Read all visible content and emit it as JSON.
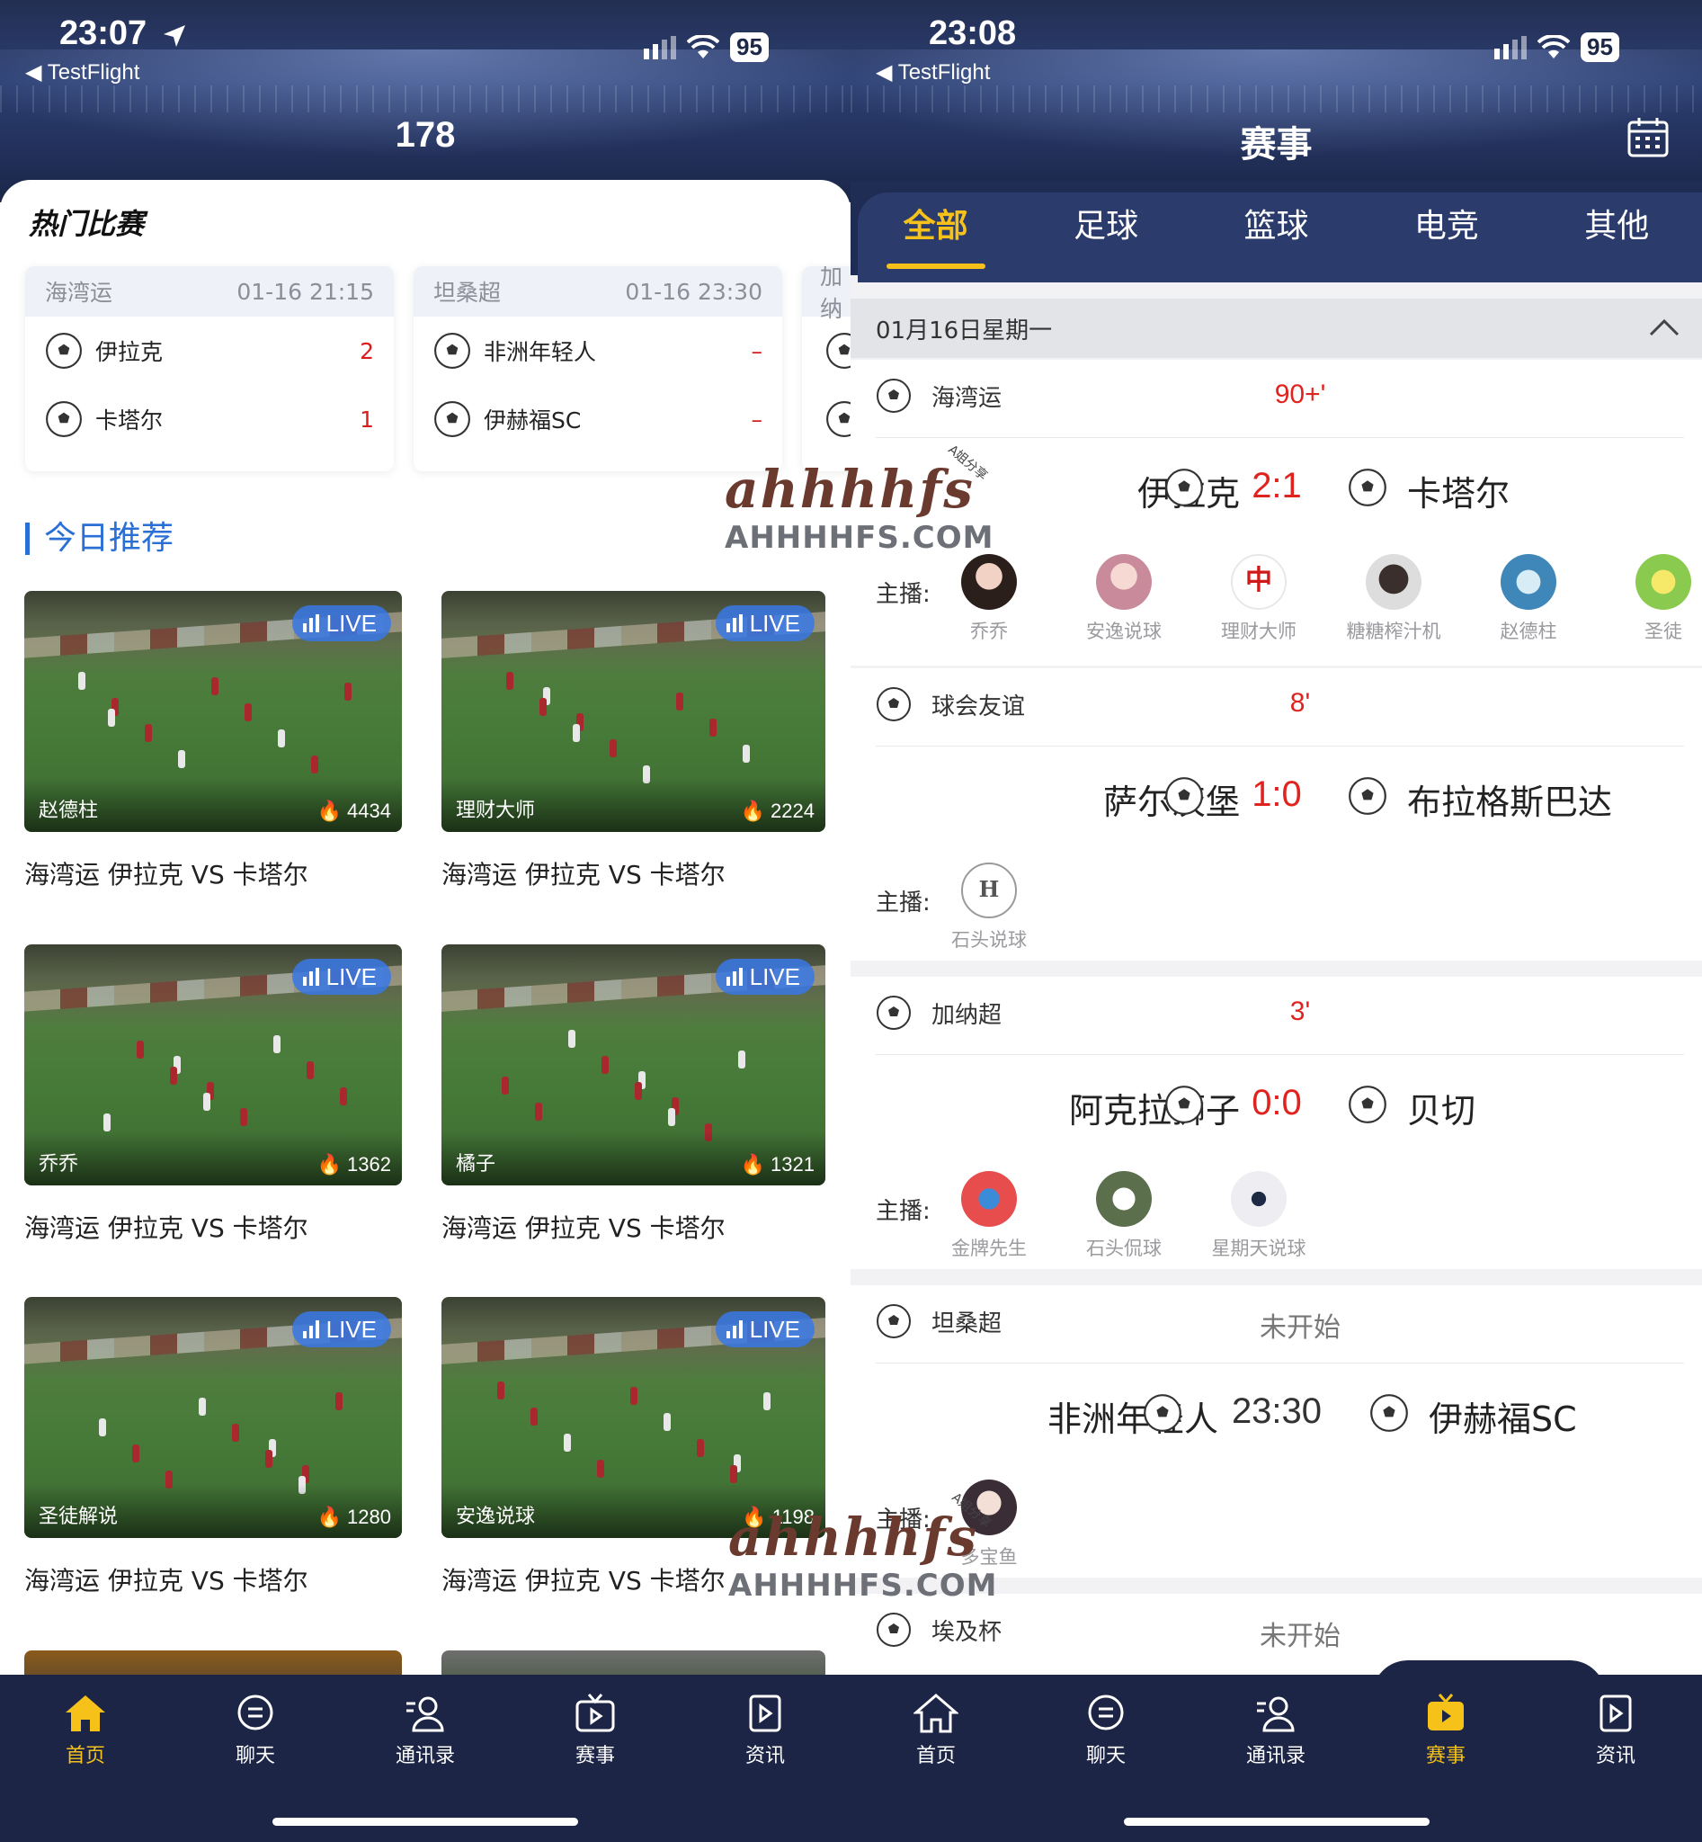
{
  "left": {
    "status": {
      "time": "23:07",
      "back": "TestFlight",
      "battery": "95"
    },
    "title": "178",
    "hot_title": "热门比赛",
    "matches": [
      {
        "league": "海湾运",
        "time": "01-16 21:15",
        "home": "伊拉克",
        "home_score": "2",
        "away": "卡塔尔",
        "away_score": "1"
      },
      {
        "league": "坦桑超",
        "time": "01-16 23:30",
        "home": "非洲年轻人",
        "home_score": "–",
        "away": "伊赫福SC",
        "away_score": "–"
      },
      {
        "league": "加纳"
      }
    ],
    "rec_title": "今日推荐",
    "live_label": "LIVE",
    "videos": [
      {
        "anchor": "赵德柱",
        "heat": "4434",
        "title": "海湾运 伊拉克 VS 卡塔尔"
      },
      {
        "anchor": "理财大师",
        "heat": "2224",
        "title": "海湾运 伊拉克 VS 卡塔尔"
      },
      {
        "anchor": "乔乔",
        "heat": "1362",
        "title": "海湾运 伊拉克 VS 卡塔尔"
      },
      {
        "anchor": "橘子",
        "heat": "1321",
        "title": "海湾运 伊拉克 VS 卡塔尔"
      },
      {
        "anchor": "圣徒解说",
        "heat": "1280",
        "title": "海湾运 伊拉克 VS 卡塔尔"
      },
      {
        "anchor": "安逸说球",
        "heat": "1198",
        "title": "海湾运 伊拉克 VS 卡塔尔"
      }
    ],
    "tabs": [
      {
        "label": "首页",
        "icon": "home-icon",
        "active": true
      },
      {
        "label": "聊天",
        "icon": "chat-icon",
        "active": false
      },
      {
        "label": "通讯录",
        "icon": "contacts-icon",
        "active": false
      },
      {
        "label": "赛事",
        "icon": "tv-icon",
        "active": false
      },
      {
        "label": "资讯",
        "icon": "news-icon",
        "active": false
      }
    ]
  },
  "right": {
    "status": {
      "time": "23:08",
      "back": "TestFlight",
      "battery": "95"
    },
    "title": "赛事",
    "categories": [
      "全部",
      "足球",
      "篮球",
      "电竞",
      "其他"
    ],
    "active_category": "全部",
    "date_header": "01月16日星期一",
    "host_label": "主播:",
    "matches": [
      {
        "league": "海湾运",
        "status": "90+'",
        "home": "伊拉克",
        "score": "2:1",
        "away": "卡塔尔",
        "hosts": [
          "乔乔",
          "安逸说球",
          "理财大师",
          "糖糖榨汁机",
          "赵德柱",
          "圣徒"
        ]
      },
      {
        "league": "球会友谊",
        "status": "8'",
        "home": "萨尔茨堡",
        "score": "1:0",
        "away": "布拉格斯巴达",
        "hosts": [
          "石头说球"
        ]
      },
      {
        "league": "加纳超",
        "status": "3'",
        "home": "阿克拉狮子",
        "score": "0:0",
        "away": "贝切",
        "hosts": [
          "金牌先生",
          "石头侃球",
          "星期天说球"
        ]
      },
      {
        "league": "坦桑超",
        "status": "未开始",
        "home": "非洲年轻人",
        "score": "23:30",
        "away": "伊赫福SC",
        "hosts": [
          "多宝鱼"
        ]
      },
      {
        "league": "埃及杯",
        "status": "未开始"
      }
    ],
    "tabs": [
      {
        "label": "首页",
        "icon": "home-icon",
        "active": false
      },
      {
        "label": "聊天",
        "icon": "chat-icon",
        "active": false
      },
      {
        "label": "通讯录",
        "icon": "contacts-icon",
        "active": false
      },
      {
        "label": "赛事",
        "icon": "tv-icon",
        "active": true
      },
      {
        "label": "资讯",
        "icon": "news-icon",
        "active": false
      }
    ]
  },
  "watermark": {
    "line1": "ahhhhfs",
    "line2": "AHHHHFS.COM",
    "tag": "A姐分享"
  },
  "colors": {
    "accent": "#f6c21a",
    "live": "#3878e6",
    "score": "#e0231e",
    "nav": "#1c2546"
  }
}
